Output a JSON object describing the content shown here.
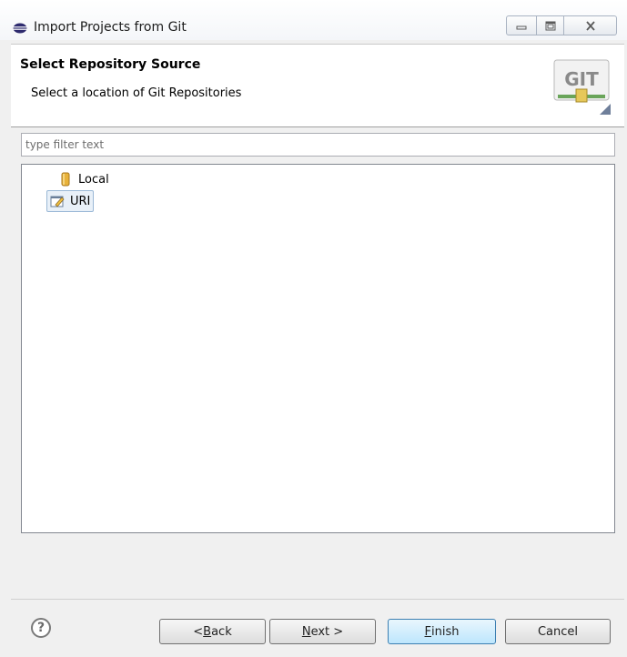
{
  "window": {
    "title": "Import Projects from Git",
    "controls": {
      "minimize": "minimize",
      "maximize": "maximize",
      "close": "close"
    }
  },
  "header": {
    "title": "Select Repository Source",
    "description": "Select a location of Git Repositories",
    "logo_text": "GIT"
  },
  "filter": {
    "placeholder": "type filter text",
    "value": ""
  },
  "tree": {
    "items": [
      {
        "label": "Local",
        "icon": "database-icon",
        "selected": false
      },
      {
        "label": "URI",
        "icon": "edit-uri-icon",
        "selected": true
      }
    ]
  },
  "footer": {
    "help_label": "?",
    "back": {
      "prefix": "< ",
      "mnemonic": "B",
      "rest": "ack"
    },
    "next": {
      "mnemonic": "N",
      "rest": "ext >"
    },
    "finish": {
      "mnemonic": "F",
      "rest": "inish"
    },
    "cancel": {
      "label": "Cancel"
    }
  },
  "colors": {
    "primary_button": "#bde6fd",
    "selection": "#e8f0f8",
    "git_logo_green": "#6aa55a"
  }
}
